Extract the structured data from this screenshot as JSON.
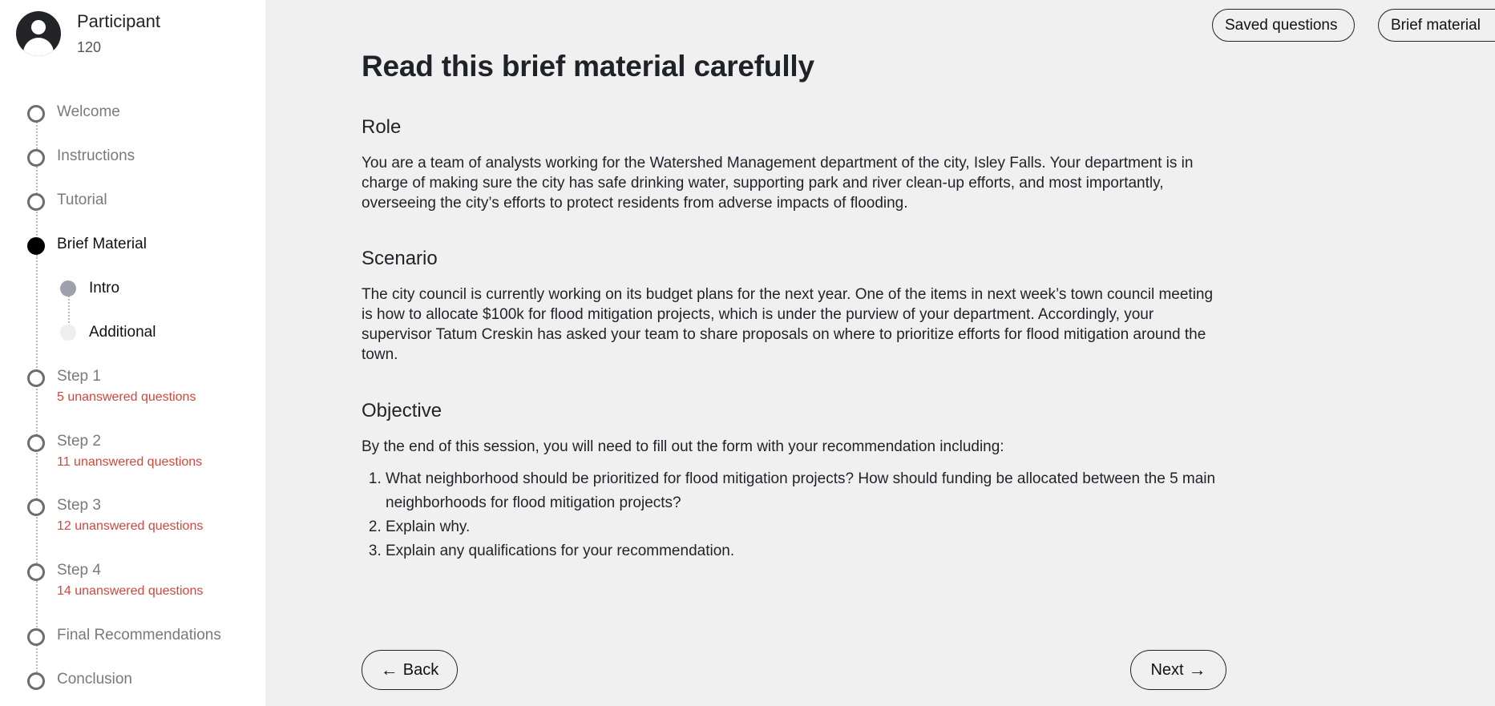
{
  "participant": {
    "name": "Participant",
    "id": "120"
  },
  "steps": [
    {
      "label": "Welcome"
    },
    {
      "label": "Instructions"
    },
    {
      "label": "Tutorial"
    },
    {
      "label": "Brief Material",
      "active": true
    },
    {
      "label": "Step 1",
      "warning": "5 unanswered questions"
    },
    {
      "label": "Step 2",
      "warning": "11 unanswered questions"
    },
    {
      "label": "Step 3",
      "warning": "12 unanswered questions"
    },
    {
      "label": "Step 4",
      "warning": "14 unanswered questions"
    },
    {
      "label": "Final Recommendations"
    },
    {
      "label": "Conclusion"
    }
  ],
  "substeps": [
    {
      "label": "Intro"
    },
    {
      "label": "Additional"
    }
  ],
  "header": {
    "saved_label": "Saved questions",
    "brief_label": "Brief material"
  },
  "page": {
    "title": "Read this brief material carefully",
    "role_heading": "Role",
    "role_text": "You are a team of analysts working for the Watershed Management department of the city, Isley Falls. Your department is in charge of making sure the city has safe drinking water, supporting park and river clean-up efforts, and most importantly, overseeing the city’s efforts to protect residents from adverse impacts of flooding.",
    "scenario_heading": "Scenario",
    "scenario_text": "The city council is currently working on its budget plans for the next year. One of the items in next week’s town council meeting is how to allocate $100k for flood mitigation projects, which is under the purview of your department. Accordingly, your supervisor Tatum Creskin has asked your team to share proposals on where to prioritize efforts for flood mitigation around the town.",
    "objective_heading": "Objective",
    "objective_intro": "By the end of this session, you will need to fill out the form with your recommendation including:",
    "objectives": [
      "What neighborhood should be prioritized for flood mitigation projects? How should funding be allocated between the 5 main neighborhoods for flood mitigation projects?",
      "Explain why.",
      "Explain any qualifications for your recommendation."
    ]
  },
  "nav": {
    "back_label": "Back",
    "next_label": "Next"
  },
  "icons": {
    "back": "arrow-left-icon",
    "next": "arrow-right-icon",
    "avatar": "user-avatar-icon"
  }
}
